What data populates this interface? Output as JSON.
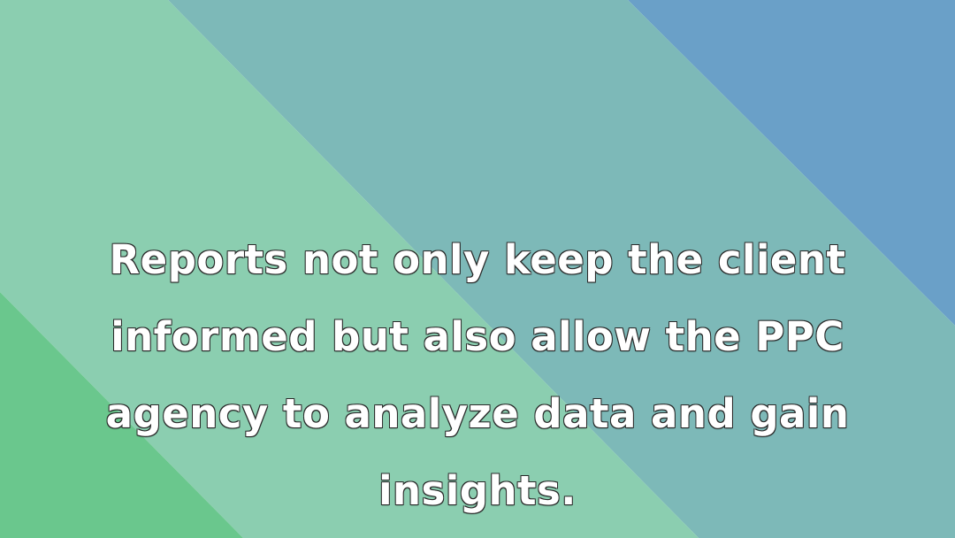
{
  "slide": {
    "quote": "Reports not only keep the client informed but also allow the PPC agency to analyze data and gain insights."
  },
  "colors": {
    "band_green_dark": "#6ac78d",
    "band_green_light": "#8bceb0",
    "band_teal": "#7db9b8",
    "band_blue": "#6aa0c8",
    "text": "#ffffff",
    "text_outline": "#2a2a2a"
  }
}
